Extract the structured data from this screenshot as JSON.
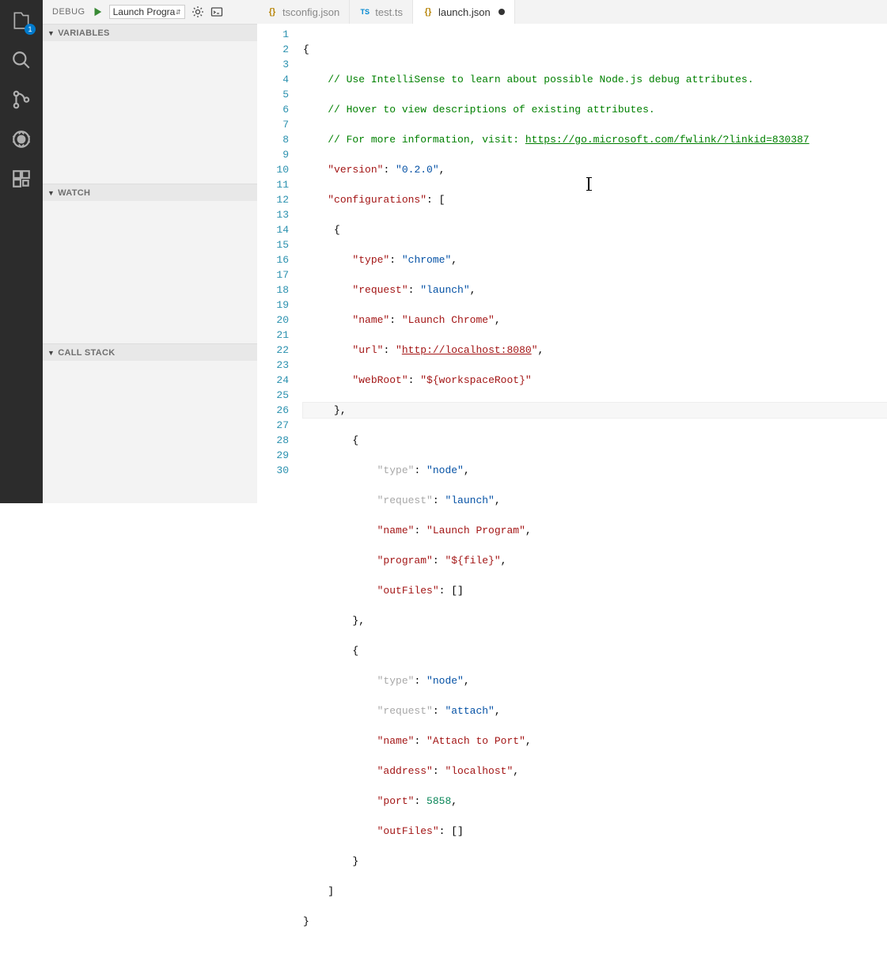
{
  "activityBar": {
    "explorerBadge": "1"
  },
  "debug": {
    "label": "DEBUG",
    "selectedConfig": "Launch Progra"
  },
  "sidebar": {
    "variables": "VARIABLES",
    "watch": "WATCH",
    "callstack": "CALL STACK"
  },
  "tabs": [
    {
      "icon": "json",
      "label": "tsconfig.json",
      "active": false,
      "dirty": false
    },
    {
      "icon": "ts",
      "label": "test.ts",
      "active": false,
      "dirty": false
    },
    {
      "icon": "json",
      "label": "launch.json",
      "active": true,
      "dirty": true
    }
  ],
  "code": {
    "comment1": "// Use IntelliSense to learn about possible Node.js debug attributes.",
    "comment2": "// Hover to view descriptions of existing attributes.",
    "comment3a": "// For more information, visit: ",
    "comment3url": "https://go.microsoft.com/fwlink/?linkid=830387",
    "k_version": "\"version\"",
    "v_version": "\"0.2.0\"",
    "k_configurations": "\"configurations\"",
    "k_type": "\"type\"",
    "v_chrome": "\"chrome\"",
    "k_request": "\"request\"",
    "v_launch": "\"launch\"",
    "k_name": "\"name\"",
    "v_launchChrome": "\"Launch Chrome\"",
    "k_url": "\"url\"",
    "v_url_q": "\"",
    "v_url": "http://localhost:8080",
    "k_webRoot": "\"webRoot\"",
    "v_webRoot": "\"${workspaceRoot}\"",
    "v_node": "\"node\"",
    "v_launchProgram": "\"Launch Program\"",
    "k_program": "\"program\"",
    "v_program": "\"${file}\"",
    "k_outFiles": "\"outFiles\"",
    "v_outFiles": "[]",
    "v_attach": "\"attach\"",
    "v_attachToPort": "\"Attach to Port\"",
    "k_address": "\"address\"",
    "v_address": "\"localhost\"",
    "k_port": "\"port\"",
    "v_port": "5858"
  },
  "lineCount": 30
}
